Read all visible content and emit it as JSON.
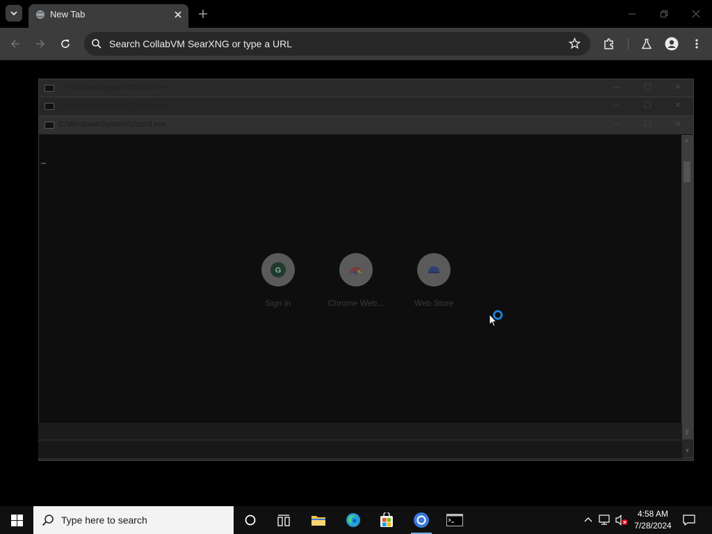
{
  "browser": {
    "tab": {
      "title": "New Tab"
    },
    "omnibox": {
      "placeholder": "Search CollabVM SearXNG or type a URL"
    }
  },
  "cmd_windows": [
    {
      "title": "C:\\Windows\\System32\\cmd.exe"
    },
    {
      "title": "C:\\Windows\\System32\\cmd.exe"
    },
    {
      "title": "C:\\Windows\\System32\\cmd.exe"
    }
  ],
  "shortcuts": [
    {
      "label": "Sign in",
      "icon": "google-account-icon",
      "glyph": "G"
    },
    {
      "label": "Chrome Web...",
      "icon": "chrome-web-store-icon",
      "glyph": ""
    },
    {
      "label": "Web Store",
      "icon": "web-store-icon",
      "glyph": ""
    }
  ],
  "taskbar": {
    "search_placeholder": "Type here to search",
    "clock": {
      "time": "4:58 AM",
      "date": "7/28/2024"
    }
  },
  "colors": {
    "accent": "#1e7fd8",
    "chrome_toolbar": "#3c3c3c",
    "taskbar": "#101010"
  }
}
